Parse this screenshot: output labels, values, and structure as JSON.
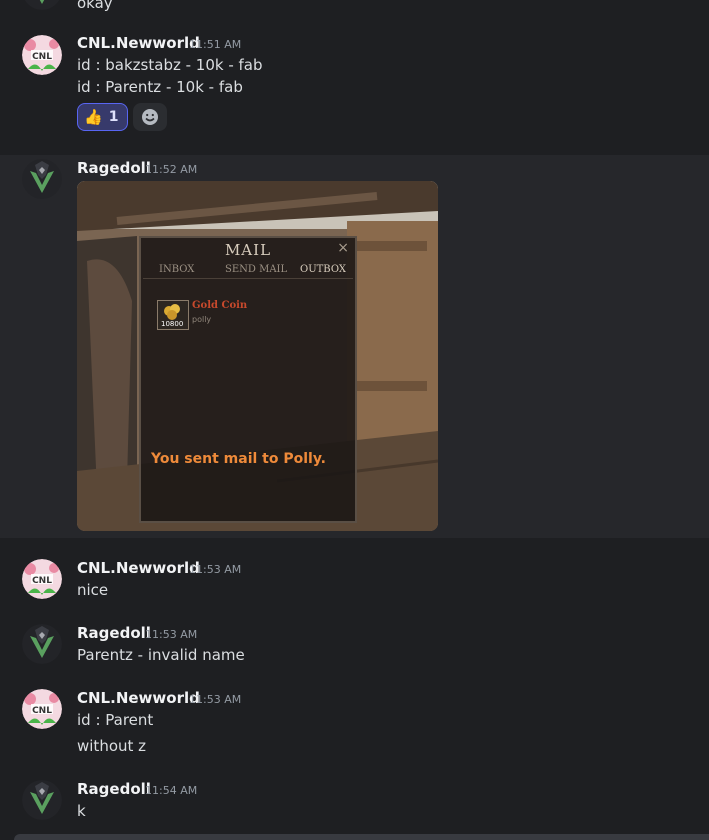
{
  "messages": [
    {
      "author": "",
      "timestamp": "",
      "lines": [
        "okay"
      ]
    },
    {
      "author": "CNL.Newworld",
      "timestamp": "11:51 AM",
      "lines": [
        "id : bakzstabz -  10k - fab",
        "id : Parentz - 10k - fab"
      ],
      "reaction": {
        "emoji": "👍",
        "count": "1"
      }
    },
    {
      "author": "Ragedoll",
      "timestamp": "11:52 AM",
      "lines": []
    },
    {
      "author": "CNL.Newworld",
      "timestamp": "11:53 AM",
      "lines": [
        "nice"
      ]
    },
    {
      "author": "Ragedoll",
      "timestamp": "11:53 AM",
      "lines": [
        "Parentz - invalid name"
      ]
    },
    {
      "author": "CNL.Newworld",
      "timestamp": "11:53 AM",
      "lines": [
        "id : Parent",
        "without z"
      ]
    },
    {
      "author": "Ragedoll",
      "timestamp": "11:54 AM",
      "lines": [
        "k"
      ]
    }
  ],
  "attachment": {
    "mail_title": "MAIL",
    "close": "×",
    "tabs": [
      "INBOX",
      "SEND MAIL",
      "OUTBOX"
    ],
    "item_title": "Gold Coin",
    "item_qty": "10800",
    "item_sub": "polly",
    "status": "You sent mail to Polly."
  },
  "avatar_logo_text": "CNL",
  "colors": {
    "accent": "#5865f2",
    "status_text": "#ee8a3a"
  },
  "icons": {
    "add_reaction": "smiley-face-icon",
    "thumbs_up": "thumbs-up-icon"
  }
}
